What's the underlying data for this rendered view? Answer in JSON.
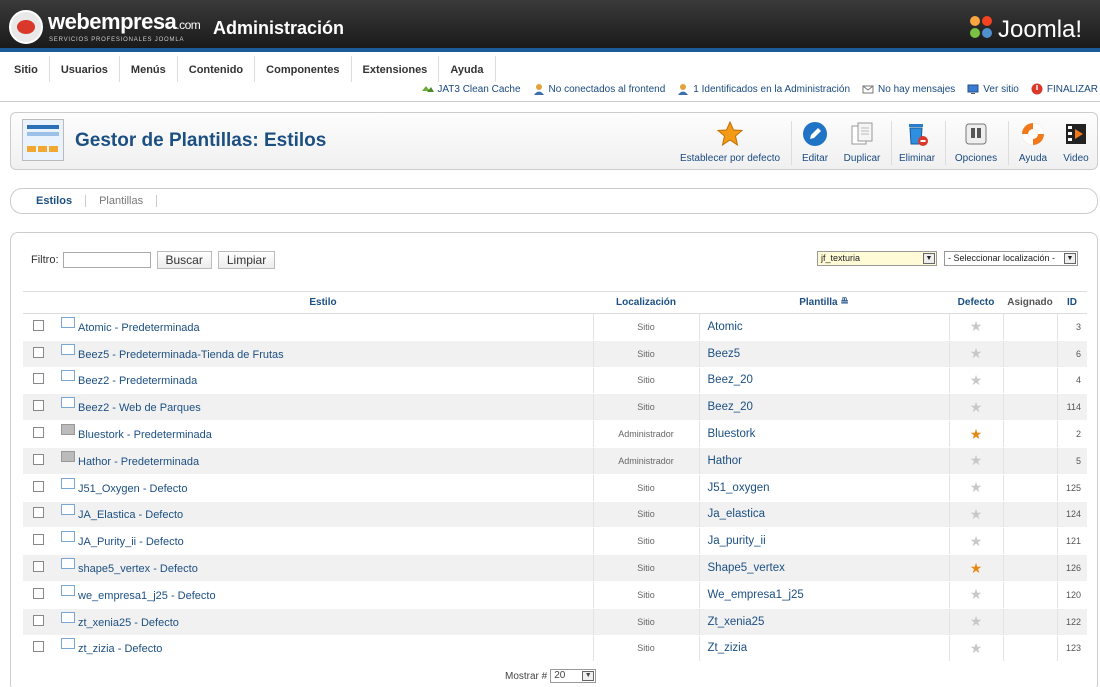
{
  "header": {
    "brand": "webempresa",
    "brand_suffix": ".com",
    "brand_tagline": "SERVICIOS PROFESIONALES JOOMLA",
    "title": "Administración",
    "cms_logo": "Joomla!"
  },
  "menu": [
    "Sitio",
    "Usuarios",
    "Menús",
    "Contenido",
    "Componentes",
    "Extensiones",
    "Ayuda"
  ],
  "status": [
    {
      "icon": "cache-icon",
      "label": "JAT3 Clean Cache"
    },
    {
      "icon": "user-icon",
      "label": "No conectados al frontend"
    },
    {
      "icon": "user-icon",
      "label": "1 Identificados en la Administración"
    },
    {
      "icon": "mail-icon",
      "label": "No hay mensajes"
    },
    {
      "icon": "monitor-icon",
      "label": "Ver sitio"
    },
    {
      "icon": "power-icon",
      "label": "FINALIZAR"
    }
  ],
  "toolbar": {
    "page_title": "Gestor de Plantillas: Estilos",
    "set_default": "Establecer por defecto",
    "edit": "Editar",
    "duplicate": "Duplicar",
    "delete": "Eliminar",
    "options": "Opciones",
    "help": "Ayuda",
    "video": "Video"
  },
  "submenu": {
    "styles": "Estilos",
    "templates": "Plantillas"
  },
  "filter": {
    "label": "Filtro:",
    "value": "",
    "search_button": "Buscar",
    "clear_button": "Limpiar",
    "template_select": "jf_texturia",
    "location_select": "- Seleccionar localización -"
  },
  "table": {
    "headers": {
      "style": "Estilo",
      "location": "Localización",
      "template": "Plantilla",
      "default": "Defecto",
      "assigned": "Asignado",
      "id": "ID"
    },
    "rows": [
      {
        "style": "Atomic - Predeterminada",
        "location": "Sitio",
        "template": "Atomic",
        "default": false,
        "id": "3"
      },
      {
        "style": "Beez5 - Predeterminada-Tienda de Frutas",
        "location": "Sitio",
        "template": "Beez5",
        "default": false,
        "id": "6"
      },
      {
        "style": "Beez2 - Predeterminada",
        "location": "Sitio",
        "template": "Beez_20",
        "default": false,
        "id": "4"
      },
      {
        "style": "Beez2 - Web de Parques",
        "location": "Sitio",
        "template": "Beez_20",
        "default": false,
        "id": "114"
      },
      {
        "style": "Bluestork - Predeterminada",
        "location": "Administrador",
        "template": "Bluestork",
        "default": true,
        "id": "2"
      },
      {
        "style": "Hathor - Predeterminada",
        "location": "Administrador",
        "template": "Hathor",
        "default": false,
        "id": "5"
      },
      {
        "style": "J51_Oxygen - Defecto",
        "location": "Sitio",
        "template": "J51_oxygen",
        "default": false,
        "id": "125"
      },
      {
        "style": "JA_Elastica - Defecto",
        "location": "Sitio",
        "template": "Ja_elastica",
        "default": false,
        "id": "124"
      },
      {
        "style": "JA_Purity_ii - Defecto",
        "location": "Sitio",
        "template": "Ja_purity_ii",
        "default": false,
        "id": "121"
      },
      {
        "style": "shape5_vertex - Defecto",
        "location": "Sitio",
        "template": "Shape5_vertex",
        "default": true,
        "id": "126"
      },
      {
        "style": "we_empresa1_j25 - Defecto",
        "location": "Sitio",
        "template": "We_empresa1_j25",
        "default": false,
        "id": "120"
      },
      {
        "style": "zt_xenia25 - Defecto",
        "location": "Sitio",
        "template": "Zt_xenia25",
        "default": false,
        "id": "122"
      },
      {
        "style": "zt_zizia - Defecto",
        "location": "Sitio",
        "template": "Zt_zizia",
        "default": false,
        "id": "123"
      }
    ]
  },
  "pagination": {
    "label": "Mostrar #",
    "value": "20"
  },
  "colors": {
    "link": "#1c4f82",
    "accent": "#1c5c9a",
    "star_on": "#e58a14"
  }
}
